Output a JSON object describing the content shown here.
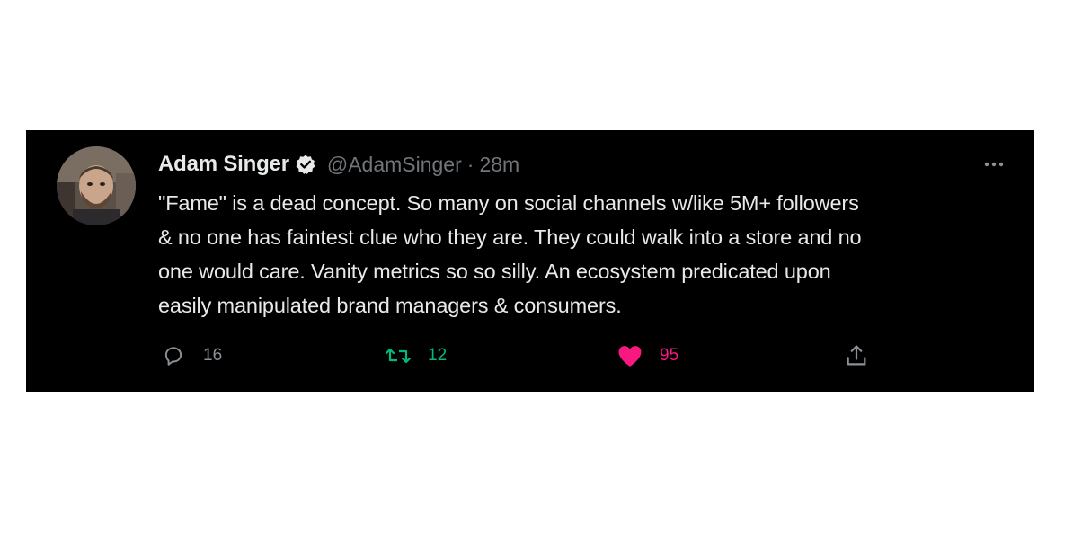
{
  "tweet": {
    "author": {
      "display_name": "Adam Singer",
      "handle": "@AdamSinger",
      "verified": true,
      "avatar_icon": "avatar-photo"
    },
    "separator": "·",
    "time": "28m",
    "text": "\"Fame\" is a dead concept. So many on social channels w/like 5M+ followers\n& no one has faintest clue who they are. They could walk into a store and no\none would care. Vanity metrics so so silly. An ecosystem predicated upon\neasily manipulated brand managers & consumers.",
    "actions": {
      "reply": {
        "icon": "reply-icon",
        "count": "16"
      },
      "retweet": {
        "icon": "retweet-icon",
        "count": "12"
      },
      "like": {
        "icon": "heart-icon",
        "count": "95",
        "liked": true
      },
      "share": {
        "icon": "share-icon"
      }
    },
    "more_icon": "more-icon"
  },
  "colors": {
    "card_background": "#000000",
    "text_primary": "#e7e9ea",
    "text_secondary": "#71767b",
    "retweet_green": "#00ba7c",
    "like_pink": "#f91880"
  }
}
